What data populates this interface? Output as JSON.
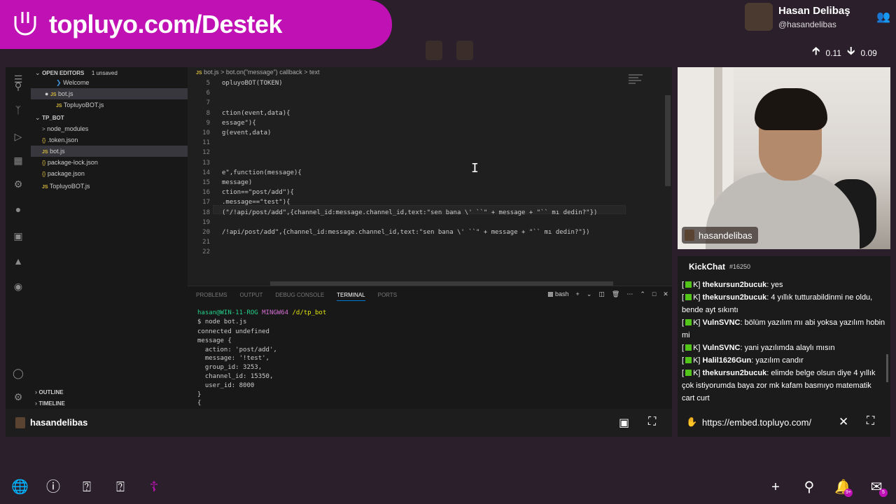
{
  "banner": {
    "text": "topluyo.com/Destek",
    "logo_icon": "topluyo-smile-icon"
  },
  "profile": {
    "name": "Hasan Delibaş",
    "handle": "@hasandelibas",
    "people_icon": "people-icon"
  },
  "vote": {
    "up": "0.11",
    "down": "0.09"
  },
  "vscode": {
    "sidebar": {
      "open_editors": "OPEN EDITORS",
      "unsaved": "1 unsaved",
      "open_files": [
        {
          "tag": "",
          "name": "Welcome"
        },
        {
          "tag": "JS",
          "name": "bot.js"
        },
        {
          "tag": "JS",
          "name": "TopluyoBOT.js"
        }
      ],
      "folder": "TP_BOT",
      "files": [
        {
          "tag": ">",
          "name": "node_modules"
        },
        {
          "tag": "{}",
          "name": ".token.json"
        },
        {
          "tag": "JS",
          "name": "bot.js"
        },
        {
          "tag": "{}",
          "name": "package-lock.json"
        },
        {
          "tag": "{}",
          "name": "package.json"
        },
        {
          "tag": "JS",
          "name": "TopluyoBOT.js"
        }
      ],
      "outline": "OUTLINE",
      "timeline": "TIMELINE"
    },
    "breadcrumb": "bot.js  >  bot.on(\"message\") callback  >  text",
    "line_numbers": [
      "5",
      "6",
      "7",
      "8",
      "9",
      "10",
      "11",
      "12",
      "13",
      "14",
      "15",
      "16",
      "17",
      "18",
      "19",
      "20",
      "21",
      "22"
    ],
    "code_lines": [
      "opluyoBOT(TOKEN)",
      "",
      "",
      "ction(event,data){",
      "essage\"){",
      "g(event,data)",
      "",
      "",
      "",
      "e\",function(message){",
      "message)",
      "ction==\"post/add\"){",
      ".message==\"test\"){",
      "(\"/!api/post/add\",{channel_id:message.channel_id,text:\"sen bana \\' ``\" + message + \"`` mı dedin?\"})",
      "",
      "/!api/post/add\",{channel_id:message.channel_id,text:\"sen bana \\' ``\" + message + \"`` mı dedin?\"})",
      "",
      ""
    ],
    "panel_tabs": [
      "PROBLEMS",
      "OUTPUT",
      "DEBUG CONSOLE",
      "TERMINAL",
      "PORTS"
    ],
    "shell": "bash",
    "terminal": {
      "user_host": "hasan@WIN-11-ROG",
      "env": "MINGW64",
      "path": "/d/tp_bot",
      "command": "$ node bot.js",
      "lines": [
        "connected undefined",
        "message {",
        "  action: 'post/add',",
        "  message: '!test',",
        "  group_id: 3253,",
        "  channel_id: 15350,",
        "  user_id: 8000",
        "}",
        "{"
      ]
    }
  },
  "stream_footer": {
    "name": "hasandelibas"
  },
  "webcam": {
    "label": "hasandelibas"
  },
  "chat": {
    "title": "KickChat",
    "id": "#16250",
    "messages": [
      {
        "user": "thekursun2bucuk",
        "text": "yes"
      },
      {
        "user": "thekursun2bucuk",
        "text": "4 yıllık tutturabildinmi ne oldu, bende ayt sıkıntı"
      },
      {
        "user": "VulnSVNC",
        "text": "bölüm yazılım mı abi yoksa yazılım hobin mi"
      },
      {
        "user": "VulnSVNC",
        "text": "yani yazılımda alaylı mısın"
      },
      {
        "user": "Halil1626Gun",
        "text": "yazılım candır"
      },
      {
        "user": "thekursun2bucuk",
        "text": "elimde belge olsun diye 4 yıllık çok istiyorumda baya zor mk kafam basmıyo matematik cart curt"
      }
    ]
  },
  "url_bar": {
    "url": "https://embed.topluyo.com/"
  },
  "bottom_bar": {
    "notif_badge": "9+",
    "mail_badge": "5"
  },
  "colors": {
    "brand": "#c012b4",
    "bg": "#2a1f2b"
  }
}
